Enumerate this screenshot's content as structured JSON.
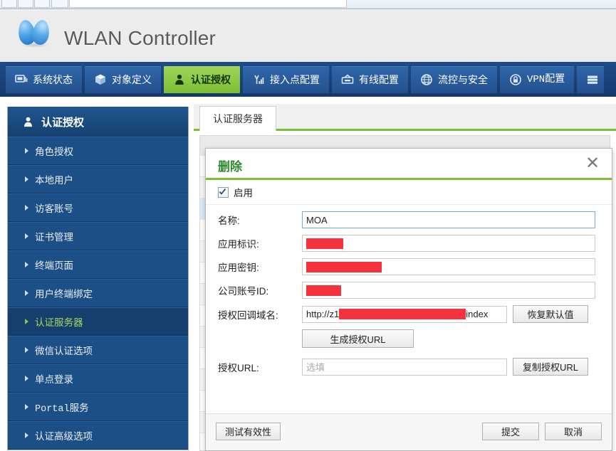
{
  "app": {
    "title": "WLAN Controller",
    "logo_icon": "heart-leaf-logo"
  },
  "top_nav": {
    "items": [
      {
        "label": "系统状态",
        "icon": "monitor-icon",
        "active": false
      },
      {
        "label": "对象定义",
        "icon": "cube-icon",
        "active": false
      },
      {
        "label": "认证授权",
        "icon": "user-lock-icon",
        "active": true
      },
      {
        "label": "接入点配置",
        "icon": "antenna-signal-icon",
        "active": false
      },
      {
        "label": "有线配置",
        "icon": "switch-box-icon",
        "active": false
      },
      {
        "label": "流控与安全",
        "icon": "globe-icon",
        "active": false
      },
      {
        "label": "VPN配置",
        "icon": "lock-circle-icon",
        "active": false
      },
      {
        "label": "",
        "icon": "server-stack-icon",
        "active": false
      }
    ]
  },
  "sidebar": {
    "header": {
      "label": "认证授权",
      "icon": "user-icon"
    },
    "items": [
      {
        "label": "角色授权",
        "active": false,
        "mono": false
      },
      {
        "label": "本地用户",
        "active": false,
        "mono": false
      },
      {
        "label": "访客账号",
        "active": false,
        "mono": false
      },
      {
        "label": "证书管理",
        "active": false,
        "mono": false
      },
      {
        "label": "终端页面",
        "active": false,
        "mono": false
      },
      {
        "label": "用户终端绑定",
        "active": false,
        "mono": false
      },
      {
        "label": "认证服务器",
        "active": true,
        "mono": false
      },
      {
        "label": "微信认证选项",
        "active": false,
        "mono": false
      },
      {
        "label": "单点登录",
        "active": false,
        "mono": false
      },
      {
        "label": "Portal服务",
        "active": false,
        "mono": true
      },
      {
        "label": "认证高级选项",
        "active": false,
        "mono": false
      }
    ]
  },
  "content": {
    "tabs": [
      {
        "label": "认证服务器",
        "active": true
      }
    ]
  },
  "modal": {
    "title": "删除",
    "close_icon": "close-icon",
    "enable": {
      "label": "启用",
      "checked": true
    },
    "fields": [
      {
        "label": "名称:",
        "value": "MOA",
        "placeholder": "",
        "redacted": false,
        "focused": true
      },
      {
        "label": "应用标识:",
        "value": "",
        "placeholder": "",
        "redacted": true,
        "redact_width": 52,
        "focused": false
      },
      {
        "label": "应用密钥:",
        "value": "",
        "placeholder": "",
        "redacted": true,
        "redact_width": 106,
        "focused": false
      },
      {
        "label": "公司账号ID:",
        "value": "",
        "placeholder": "",
        "redacted": true,
        "redact_width": 49,
        "focused": false
      }
    ],
    "callback_domain": {
      "label": "授权回调域名:",
      "value_prefix": "http://z1",
      "value_suffix": "index",
      "redact_width": 178,
      "restore_button": "恢复默认值"
    },
    "generate_button": "生成授权URL",
    "auth_url": {
      "label": "授权URL:",
      "value": "",
      "placeholder": "选填",
      "copy_button": "复制授权URL"
    },
    "footer": {
      "test_button": "测试有效性",
      "submit_button": "提交",
      "cancel_button": "取消"
    }
  },
  "colors": {
    "accent_green": "#7dbf34",
    "nav_blue": "#23518e",
    "sidebar_blue": "#1d4f87",
    "title_green": "#2d8b2d",
    "redact_red": "#f5333f"
  }
}
